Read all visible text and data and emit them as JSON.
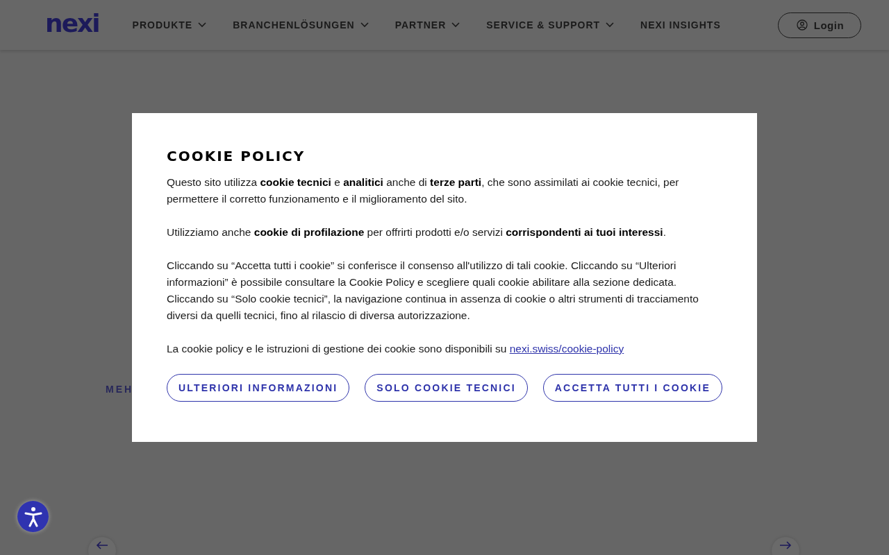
{
  "header": {
    "logo": "nexi",
    "nav": [
      {
        "label": "PRODUKTE",
        "dropdown": true
      },
      {
        "label": "BRANCHENLÖSUNGEN",
        "dropdown": true
      },
      {
        "label": "PARTNER",
        "dropdown": true
      },
      {
        "label": "SERVICE & SUPPORT",
        "dropdown": true
      },
      {
        "label": "NEXI INSIGHTS",
        "dropdown": false
      }
    ],
    "login": "Login"
  },
  "hero": {
    "link_text": "MEH"
  },
  "cookie_dialog": {
    "title": "COOKIE POLICY",
    "paragraphs": [
      "Questo sito utilizza **cookie tecnici** e **analitici** anche di **terze parti**, che sono assimilati ai cookie tecnici, per permettere il corretto funzionamento e il miglioramento del sito.",
      "Utilizziamo anche **cookie di profilazione** per offrirti prodotti e/o servizi **corrispondenti ai tuoi interessi**.",
      "Cliccando su “Accetta tutti i cookie” si conferisce il consenso all'utilizzo di tali cookie. Cliccando su “Ulteriori informazioni” è possibile consultare la Cookie Policy e scegliere quali cookie abilitare alla sezione dedicata. Cliccando su “Solo cookie tecnici”, la navigazione continua in assenza di cookie o altri strumenti di tracciamento diversi da quelli tecnici, fino al rilascio di diversa autorizzazione."
    ],
    "footer_text": "La cookie policy e le istruzioni di gestione dei cookie sono disponibili su ",
    "footer_link": "nexi.swiss/cookie-policy",
    "buttons": [
      "ULTERIORI INFORMAZIONI",
      "SOLO COOKIE TECNICI",
      "ACCETTA TUTTI I COOKIE"
    ]
  }
}
